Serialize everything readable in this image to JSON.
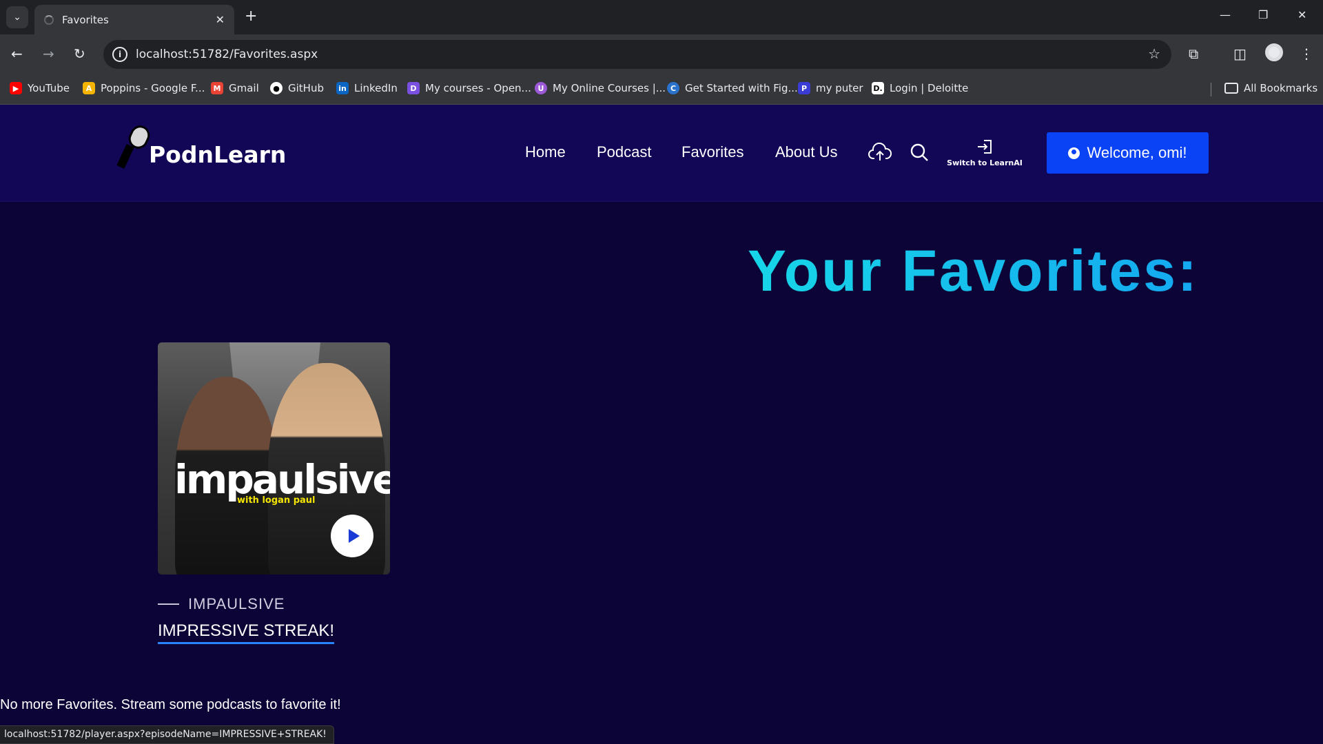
{
  "browser": {
    "tab_title": "Favorites",
    "url": "localhost:51782/Favorites.aspx",
    "status_url": "localhost:51782/player.aspx?episodeName=IMPRESSIVE+STREAK!",
    "bookmarks": [
      {
        "label": "YouTube",
        "icon": "youtube-icon",
        "color": "#ff0000"
      },
      {
        "label": "Poppins - Google F...",
        "icon": "google-fonts-icon",
        "color": "#f4b400"
      },
      {
        "label": "Gmail",
        "icon": "gmail-icon",
        "color": "#ea4335"
      },
      {
        "label": "GitHub",
        "icon": "github-icon",
        "color": "#ffffff"
      },
      {
        "label": "LinkedIn",
        "icon": "linkedin-icon",
        "color": "#0a66c2"
      },
      {
        "label": "My courses - Open...",
        "icon": "openedu-icon",
        "color": "#7b4fe0"
      },
      {
        "label": "My Online Courses |...",
        "icon": "courses-icon",
        "color": "#9b59d6"
      },
      {
        "label": "Get Started with Fig...",
        "icon": "coursera-icon",
        "color": "#2a73cc"
      },
      {
        "label": "my puter",
        "icon": "puter-icon",
        "color": "#3b3bd6"
      },
      {
        "label": "Login | Deloitte",
        "icon": "deloitte-icon",
        "color": "#ffffff"
      }
    ],
    "all_bookmarks": "All Bookmarks"
  },
  "site": {
    "logo_text": "PodnLearn",
    "nav": [
      "Home",
      "Podcast",
      "Favorites",
      "About Us"
    ],
    "learnai_label": "Switch to LearnAI",
    "welcome": "Welcome, omi!",
    "accent": "#0a42f5",
    "background": "#0c0437"
  },
  "main": {
    "title": "Your Favorites:",
    "favorites": [
      {
        "cover_brand": "impaulsive",
        "cover_sub": "with logan paul",
        "show": "IMPAULSIVE",
        "episode": "IMPRESSIVE STREAK!"
      }
    ],
    "empty_message": "No more Favorites. Stream some podcasts to favorite it!"
  }
}
